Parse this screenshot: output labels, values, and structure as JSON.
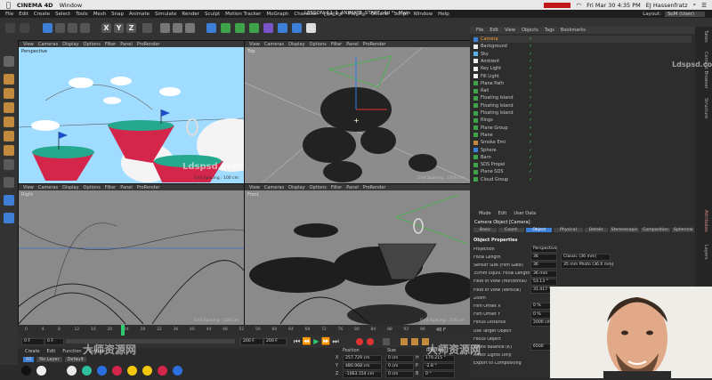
{
  "mac_menu": {
    "app": "CINEMA 4D",
    "window": "Window",
    "clock": "Fri Mar 30  4:35 PM",
    "user": "EJ Hassenfratz"
  },
  "c4d_menu": {
    "items": [
      "File",
      "Edit",
      "Create",
      "Select",
      "Tools",
      "Mesh",
      "Snap",
      "Animate",
      "Simulate",
      "Render",
      "Sculpt",
      "Motion Tracker",
      "MoGraph",
      "Character",
      "Pipeline",
      "Plugins",
      "Octane",
      "Script",
      "Window",
      "Help"
    ],
    "title": "LESSON_12_1_ANIMATE_START.c4d * - Main",
    "layout_label": "Layout:",
    "layout_value": "SoM (User)"
  },
  "toolbar": {
    "x": "X",
    "y": "Y",
    "z": "Z"
  },
  "viewport_menu": {
    "view": "View",
    "cameras": "Cameras",
    "display": "Display",
    "options": "Options",
    "filter": "Filter",
    "panel": "Panel",
    "prorender": "ProRender"
  },
  "viewports": [
    {
      "label": "Perspective",
      "grid": "Grid Spacing : 100 cm"
    },
    {
      "label": "Top",
      "grid": "Grid Spacing : 1000 cm"
    },
    {
      "label": "Right",
      "grid": "Grid Spacing : 100 cm"
    },
    {
      "label": "Front",
      "grid": "Grid Spacing : 100 cm"
    }
  ],
  "timeline": {
    "ticks": [
      "0",
      "4",
      "8",
      "12",
      "16",
      "20",
      "24",
      "28",
      "32",
      "36",
      "40",
      "44",
      "48",
      "52",
      "56",
      "60",
      "64",
      "68",
      "72",
      "76",
      "80",
      "84",
      "88",
      "92",
      "96"
    ],
    "current": "48",
    "end": "48 F"
  },
  "transport": {
    "start": "0 F",
    "in": "0 F",
    "out": "200 F",
    "end": "200 F"
  },
  "materials": {
    "tabs": [
      "Create",
      "Edit",
      "Function",
      "Texture"
    ],
    "filters": [
      "All",
      "No Layer",
      "Default"
    ]
  },
  "coords": {
    "headers": [
      "Position",
      "Size",
      "Rotation"
    ],
    "rows": [
      [
        "X",
        "257.729 cm",
        "0 cm",
        "H",
        "179.215 °"
      ],
      [
        "Y",
        "480.068 cm",
        "0 cm",
        "P",
        "-2.8 °"
      ],
      [
        "Z",
        "-1063.154 cm",
        "0 cm",
        "B",
        "0 °"
      ]
    ]
  },
  "object_manager": {
    "tabs": [
      "File",
      "Edit",
      "View",
      "Objects",
      "Tags",
      "Bookmarks"
    ],
    "objects": [
      "Camera",
      "Background",
      "Sky",
      "Ambient",
      "Key Light",
      "Fill Light",
      "Plane Path",
      "Rail",
      "Floating Island",
      "Floating Island",
      "Floating Island",
      "Rings",
      "Plane Group",
      "Plane",
      "Smoke Emi",
      "Sphere",
      "Barn",
      "SDS Propel",
      "Plane SDS",
      "Cloud Group"
    ]
  },
  "attributes": {
    "tabs": [
      "Mode",
      "Edit",
      "User Data"
    ],
    "object_title": "Camera Object [Camera]",
    "subtabs": [
      "Basic",
      "Coord.",
      "Object",
      "Physical",
      "Details",
      "Stereoscopic",
      "Composition",
      "Spherical"
    ],
    "section": "Object Properties",
    "rows": [
      {
        "label": "Projection",
        "value": "Perspective"
      },
      {
        "label": "Focal Length",
        "value": "36",
        "extra": "Classic (36 mm)"
      },
      {
        "label": "Sensor Size (Film Gate)",
        "value": "36",
        "extra": "35 mm Photo (36.0 mm)"
      },
      {
        "label": "35mm Equiv. Focal Length:",
        "value": "36 mm"
      },
      {
        "label": "Field of View (Horizontal)",
        "value": "53.13 °"
      },
      {
        "label": "Field of View (Vertical)",
        "value": "31.417 °"
      },
      {
        "label": "Zoom",
        "value": ""
      },
      {
        "label": "Film Offset X",
        "value": "0 %"
      },
      {
        "label": "Film Offset Y",
        "value": "0 %"
      },
      {
        "label": "Focus Distance",
        "value": "2000 cm"
      },
      {
        "label": "Use Target Object",
        "value": ""
      },
      {
        "label": "Focus Object",
        "value": ""
      },
      {
        "label": "White Balance (K)",
        "value": "6500"
      },
      {
        "label": "Affect Lights Only",
        "value": ""
      },
      {
        "label": "Export to Compositing",
        "value": ""
      }
    ]
  },
  "side_tabs": [
    "Takes",
    "Content Browser",
    "Structure",
    "Attributes",
    "Layers"
  ],
  "watermarks": {
    "lds": "Ldspsd.com",
    "cn": "大师资源网"
  },
  "colors": {
    "red_island": "#d4254a",
    "teal": "#26a88e",
    "sky": "#8fd3ff",
    "accent_blue": "#3d7fd6"
  }
}
